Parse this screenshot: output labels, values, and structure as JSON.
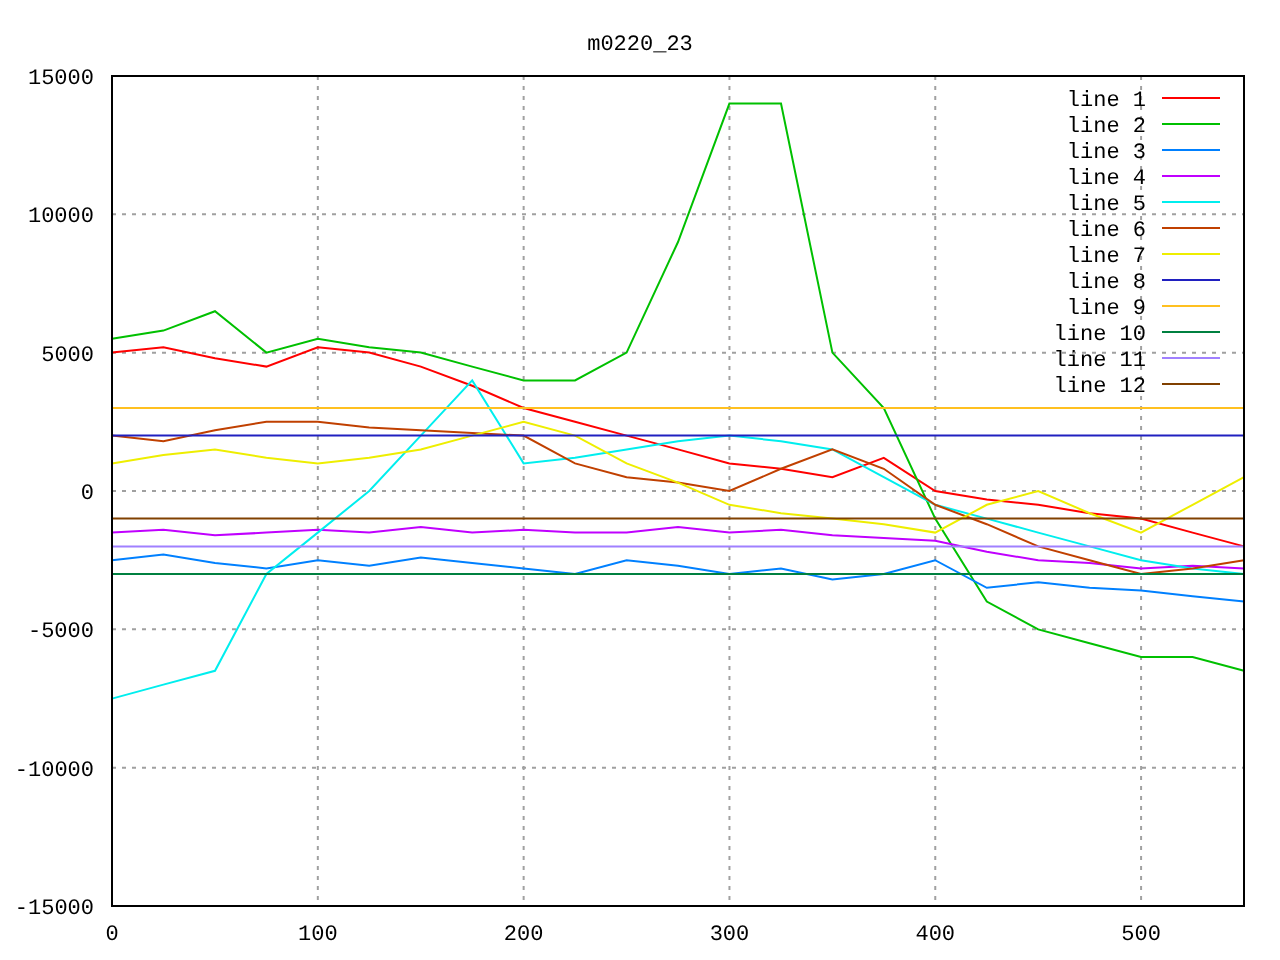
{
  "chart": {
    "chart_data": {
      "type": "line",
      "title": "m0220_23",
      "x": [
        0,
        25,
        50,
        75,
        100,
        125,
        150,
        175,
        200,
        225,
        250,
        275,
        300,
        325,
        350,
        375,
        400,
        425,
        450,
        475,
        500,
        525,
        550
      ],
      "grid": true,
      "legend": true,
      "xlim": [
        0,
        550
      ],
      "ylim": [
        -15000,
        15000
      ],
      "xticks": [
        0,
        100,
        200,
        300,
        400,
        500
      ],
      "yticks": [
        -15000,
        -10000,
        -5000,
        0,
        5000,
        10000,
        15000
      ],
      "series": [
        {
          "name": "line 1",
          "color": "#ff0000",
          "values": [
            5000,
            5200,
            4800,
            4500,
            5200,
            5000,
            4500,
            3800,
            3000,
            2500,
            2000,
            1500,
            1000,
            800,
            500,
            1200,
            0,
            -300,
            -500,
            -800,
            -1000,
            -1500,
            -2000
          ]
        },
        {
          "name": "line 2",
          "color": "#00c000",
          "values": [
            5500,
            5800,
            6500,
            5000,
            5500,
            5200,
            5000,
            4500,
            4000,
            4000,
            5000,
            9000,
            14000,
            14000,
            5000,
            3000,
            -1000,
            -4000,
            -5000,
            -5500,
            -6000,
            -6000,
            -6500
          ]
        },
        {
          "name": "line 3",
          "color": "#0080ff",
          "values": [
            -2500,
            -2300,
            -2600,
            -2800,
            -2500,
            -2700,
            -2400,
            -2600,
            -2800,
            -3000,
            -2500,
            -2700,
            -3000,
            -2800,
            -3200,
            -3000,
            -2500,
            -3500,
            -3300,
            -3500,
            -3600,
            -3800,
            -4000
          ]
        },
        {
          "name": "line 4",
          "color": "#c000ff",
          "values": [
            -1500,
            -1400,
            -1600,
            -1500,
            -1400,
            -1500,
            -1300,
            -1500,
            -1400,
            -1500,
            -1500,
            -1300,
            -1500,
            -1400,
            -1600,
            -1700,
            -1800,
            -2200,
            -2500,
            -2600,
            -2800,
            -2700,
            -2800
          ]
        },
        {
          "name": "line 5",
          "color": "#00eeee",
          "values": [
            -7500,
            -7000,
            -6500,
            -3000,
            -1500,
            0,
            2000,
            4000,
            1000,
            1200,
            1500,
            1800,
            2000,
            1800,
            1500,
            500,
            -500,
            -1000,
            -1500,
            -2000,
            -2500,
            -2800,
            -3000
          ]
        },
        {
          "name": "line 6",
          "color": "#c04000",
          "values": [
            2000,
            1800,
            2200,
            2500,
            2500,
            2300,
            2200,
            2100,
            2000,
            1000,
            500,
            300,
            0,
            800,
            1500,
            800,
            -500,
            -1200,
            -2000,
            -2500,
            -3000,
            -2800,
            -2500
          ]
        },
        {
          "name": "line 7",
          "color": "#eeee00",
          "values": [
            1000,
            1300,
            1500,
            1200,
            1000,
            1200,
            1500,
            2000,
            2500,
            2000,
            1000,
            300,
            -500,
            -800,
            -1000,
            -1200,
            -1500,
            -500,
            0,
            -800,
            -1500,
            -500,
            500
          ]
        },
        {
          "name": "line 8",
          "color": "#2020c0",
          "values": [
            2000,
            2000,
            2000,
            2000,
            2000,
            2000,
            2000,
            2000,
            2000,
            2000,
            2000,
            2000,
            2000,
            2000,
            2000,
            2000,
            2000,
            2000,
            2000,
            2000,
            2000,
            2000,
            2000
          ]
        },
        {
          "name": "line 9",
          "color": "#ffc020",
          "values": [
            3000,
            3000,
            3000,
            3000,
            3000,
            3000,
            3000,
            3000,
            3000,
            3000,
            3000,
            3000,
            3000,
            3000,
            3000,
            3000,
            3000,
            3000,
            3000,
            3000,
            3000,
            3000,
            3000
          ]
        },
        {
          "name": "line 10",
          "color": "#008040",
          "values": [
            -3000,
            -3000,
            -3000,
            -3000,
            -3000,
            -3000,
            -3000,
            -3000,
            -3000,
            -3000,
            -3000,
            -3000,
            -3000,
            -3000,
            -3000,
            -3000,
            -3000,
            -3000,
            -3000,
            -3000,
            -3000,
            -3000,
            -3000
          ]
        },
        {
          "name": "line 11",
          "color": "#a080ff",
          "values": [
            -2000,
            -2000,
            -2000,
            -2000,
            -2000,
            -2000,
            -2000,
            -2000,
            -2000,
            -2000,
            -2000,
            -2000,
            -2000,
            -2000,
            -2000,
            -2000,
            -2000,
            -2000,
            -2000,
            -2000,
            -2000,
            -2000,
            -2000
          ]
        },
        {
          "name": "line 12",
          "color": "#804000",
          "values": [
            -1000,
            -1000,
            -1000,
            -1000,
            -1000,
            -1000,
            -1000,
            -1000,
            -1000,
            -1000,
            -1000,
            -1000,
            -1000,
            -1000,
            -1000,
            -1000,
            -1000,
            -1000,
            -1000,
            -1000,
            -1000,
            -1000,
            -1000
          ]
        }
      ]
    }
  }
}
